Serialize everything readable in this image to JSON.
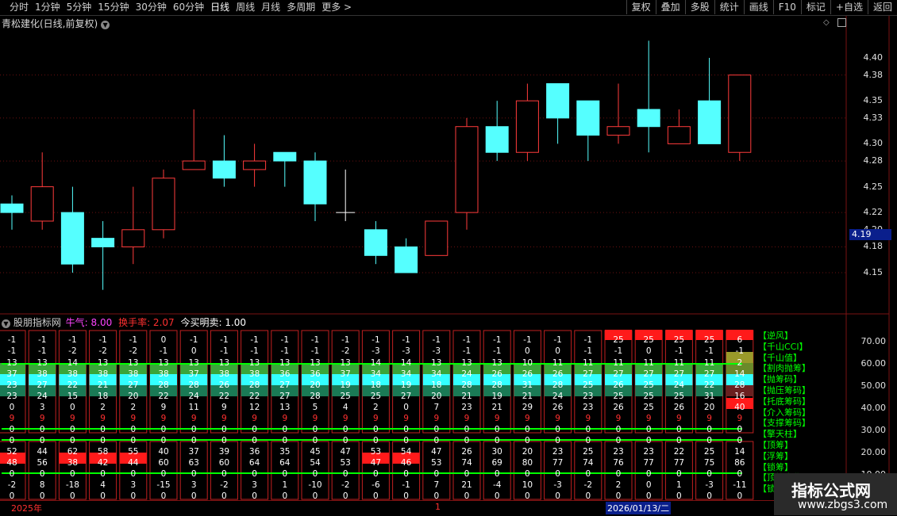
{
  "toolbar": {
    "periods": [
      "分时",
      "1分钟",
      "5分钟",
      "15分钟",
      "30分钟",
      "60分钟",
      "日线",
      "周线",
      "月线",
      "多周期",
      "更多 >"
    ],
    "active_period": "日线",
    "tools": [
      "复权",
      "叠加",
      "多股",
      "统计",
      "画线",
      "F10",
      "标记",
      "+自选",
      "返回"
    ]
  },
  "main_chart": {
    "title": "青松建化(日线,前复权)",
    "price_tag": "4.19",
    "colors": {
      "up": "#ff3b3b",
      "down": "#55ffff",
      "cross": "#ffffff"
    },
    "y_labels": [
      "4.40",
      "4.38",
      "4.35",
      "4.33",
      "4.30",
      "4.28",
      "4.25",
      "4.22",
      "4.20",
      "4.18",
      "4.15"
    ],
    "candles": [
      {
        "o": 4.22,
        "c": 4.23,
        "h": 4.24,
        "l": 4.2,
        "t": "down"
      },
      {
        "o": 4.21,
        "c": 4.25,
        "h": 4.29,
        "l": 4.2,
        "t": "up"
      },
      {
        "o": 4.22,
        "c": 4.16,
        "h": 4.25,
        "l": 4.15,
        "t": "down"
      },
      {
        "o": 4.18,
        "c": 4.19,
        "h": 4.21,
        "l": 4.13,
        "t": "down"
      },
      {
        "o": 4.18,
        "c": 4.2,
        "h": 4.25,
        "l": 4.16,
        "t": "up"
      },
      {
        "o": 4.2,
        "c": 4.26,
        "h": 4.27,
        "l": 4.19,
        "t": "up"
      },
      {
        "o": 4.27,
        "c": 4.28,
        "h": 4.34,
        "l": 4.27,
        "t": "up"
      },
      {
        "o": 4.28,
        "c": 4.26,
        "h": 4.31,
        "l": 4.25,
        "t": "down"
      },
      {
        "o": 4.27,
        "c": 4.28,
        "h": 4.3,
        "l": 4.25,
        "t": "up"
      },
      {
        "o": 4.29,
        "c": 4.28,
        "h": 4.29,
        "l": 4.25,
        "t": "down"
      },
      {
        "o": 4.28,
        "c": 4.23,
        "h": 4.29,
        "l": 4.21,
        "t": "down"
      },
      {
        "o": 4.22,
        "c": 4.22,
        "h": 4.27,
        "l": 4.21,
        "t": "cross"
      },
      {
        "o": 4.2,
        "c": 4.17,
        "h": 4.21,
        "l": 4.16,
        "t": "down"
      },
      {
        "o": 4.18,
        "c": 4.15,
        "h": 4.19,
        "l": 4.15,
        "t": "down"
      },
      {
        "o": 4.17,
        "c": 4.21,
        "h": 4.21,
        "l": 4.17,
        "t": "up"
      },
      {
        "o": 4.22,
        "c": 4.32,
        "h": 4.33,
        "l": 4.2,
        "t": "up"
      },
      {
        "o": 4.32,
        "c": 4.29,
        "h": 4.35,
        "l": 4.28,
        "t": "down"
      },
      {
        "o": 4.29,
        "c": 4.35,
        "h": 4.37,
        "l": 4.28,
        "t": "up"
      },
      {
        "o": 4.37,
        "c": 4.33,
        "h": 4.37,
        "l": 4.3,
        "t": "down"
      },
      {
        "o": 4.35,
        "c": 4.31,
        "h": 4.35,
        "l": 4.28,
        "t": "down"
      },
      {
        "o": 4.31,
        "c": 4.32,
        "h": 4.37,
        "l": 4.3,
        "t": "up"
      },
      {
        "o": 4.34,
        "c": 4.32,
        "h": 4.42,
        "l": 4.29,
        "t": "down"
      },
      {
        "o": 4.3,
        "c": 4.32,
        "h": 4.34,
        "l": 4.3,
        "t": "up"
      },
      {
        "o": 4.35,
        "c": 4.3,
        "h": 4.4,
        "l": 4.3,
        "t": "down"
      },
      {
        "o": 4.29,
        "c": 4.38,
        "h": 4.38,
        "l": 4.28,
        "t": "up"
      }
    ]
  },
  "sub_chart": {
    "indicator_name": "股朋指标网",
    "niuqi_label": "牛气: 8.00",
    "turnover_label": "换手率: 2.07",
    "today_label": "今买明卖: 1.00",
    "y_labels": [
      "70.00",
      "60.00",
      "50.00",
      "40.00",
      "30.00",
      "20.00",
      "10.00"
    ],
    "legend": [
      "【逆风】",
      "【千山CCI】",
      "【千山值】",
      "【割肉抛筹】",
      "【抛筹码】",
      "【抛压筹码】",
      "【托底筹码】",
      "【介入筹码】",
      "【支撑筹码】",
      "【擎天柱】",
      "【顶筹】",
      "【浮筹】",
      "【锁筹】",
      "【顶筹变化】",
      "【锁筹变化】"
    ],
    "rows": {
      "r1": [
        "-1",
        "-1",
        "-1",
        "-1",
        "-1",
        "0",
        "-1",
        "-1",
        "-1",
        "-1",
        "-1",
        "-1",
        "-1",
        "-1",
        "-1",
        "-1",
        "-1",
        "-1",
        "-1",
        "-1",
        "25",
        "25",
        "25",
        "25",
        "6"
      ],
      "r2": [
        "-1",
        "-1",
        "-2",
        "-2",
        "-2",
        "-1",
        "0",
        "-1",
        "-1",
        "-1",
        "-1",
        "-2",
        "-3",
        "-3",
        "-3",
        "-1",
        "-1",
        "0",
        "0",
        "-1",
        "-1",
        "0",
        "-1",
        "-1",
        "-1"
      ],
      "r3": [
        "13",
        "13",
        "14",
        "13",
        "13",
        "13",
        "13",
        "13",
        "13",
        "13",
        "13",
        "13",
        "14",
        "14",
        "13",
        "13",
        "13",
        "10",
        "11",
        "11",
        "11",
        "11",
        "11",
        "11",
        "2"
      ],
      "r4": [
        "37",
        "38",
        "38",
        "38",
        "38",
        "38",
        "37",
        "38",
        "38",
        "36",
        "36",
        "37",
        "34",
        "34",
        "34",
        "24",
        "26",
        "26",
        "26",
        "27",
        "27",
        "27",
        "27",
        "27",
        "14"
      ],
      "r5": [
        "23",
        "27",
        "22",
        "21",
        "27",
        "28",
        "28",
        "26",
        "28",
        "27",
        "20",
        "19",
        "18",
        "19",
        "18",
        "28",
        "28",
        "31",
        "28",
        "25",
        "26",
        "25",
        "24",
        "22",
        "28"
      ],
      "r6": [
        "23",
        "24",
        "15",
        "18",
        "20",
        "22",
        "24",
        "22",
        "22",
        "27",
        "28",
        "25",
        "25",
        "27",
        "20",
        "21",
        "19",
        "21",
        "24",
        "23",
        "25",
        "25",
        "25",
        "31",
        "16"
      ],
      "r7": [
        "0",
        "3",
        "0",
        "2",
        "2",
        "9",
        "11",
        "9",
        "12",
        "13",
        "5",
        "4",
        "2",
        "0",
        "7",
        "23",
        "21",
        "29",
        "26",
        "23",
        "26",
        "25",
        "26",
        "20",
        "40"
      ],
      "r8": [
        "9",
        "9",
        "9",
        "9",
        "9",
        "9",
        "9",
        "9",
        "9",
        "9",
        "9",
        "9",
        "9",
        "9",
        "9",
        "9",
        "9",
        "9",
        "9",
        "9",
        "9",
        "9",
        "9",
        "9",
        "9"
      ],
      "r9": [
        "0",
        "0",
        "0",
        "0",
        "0",
        "0",
        "0",
        "0",
        "0",
        "0",
        "0",
        "0",
        "0",
        "0",
        "0",
        "0",
        "0",
        "0",
        "0",
        "0",
        "0",
        "0",
        "0",
        "0",
        "0"
      ],
      "r10": [
        "0",
        "0",
        "0",
        "0",
        "0",
        "0",
        "0",
        "0",
        "0",
        "0",
        "0",
        "0",
        "0",
        "0",
        "0",
        "0",
        "0",
        "0",
        "0",
        "0",
        "0",
        "0",
        "0",
        "0",
        "0"
      ],
      "r11": [
        "52",
        "44",
        "62",
        "58",
        "55",
        "40",
        "37",
        "39",
        "36",
        "35",
        "45",
        "47",
        "53",
        "54",
        "47",
        "26",
        "30",
        "20",
        "23",
        "25",
        "23",
        "23",
        "22",
        "25",
        "14"
      ],
      "r12": [
        "48",
        "56",
        "38",
        "42",
        "44",
        "60",
        "63",
        "60",
        "64",
        "64",
        "54",
        "53",
        "47",
        "46",
        "53",
        "74",
        "69",
        "80",
        "77",
        "74",
        "76",
        "77",
        "77",
        "75",
        "86"
      ],
      "r13": [
        "0",
        "0",
        "0",
        "0",
        "0",
        "0",
        "0",
        "0",
        "0",
        "0",
        "0",
        "0",
        "0",
        "0",
        "0",
        "0",
        "0",
        "0",
        "0",
        "0",
        "0",
        "0",
        "0",
        "0",
        "0"
      ],
      "r14": [
        "-2",
        "8",
        "-18",
        "4",
        "3",
        "-15",
        "3",
        "-2",
        "3",
        "1",
        "-10",
        "-2",
        "-6",
        "-1",
        "7",
        "21",
        "-4",
        "10",
        "-3",
        "-2",
        "2",
        "0",
        "1",
        "-3",
        "-11"
      ],
      "r15": [
        "0",
        "0",
        "0",
        "0",
        "0",
        "0",
        "0",
        "0",
        "0",
        "0",
        "0",
        "0",
        "0",
        "0",
        "0",
        "0",
        "0",
        "0",
        "0",
        "0",
        "0",
        "0",
        "0",
        "0",
        "0"
      ]
    },
    "highlights": {
      "r1_red_from": 20,
      "r12_red_cols": [
        0,
        2,
        3,
        4,
        12,
        13
      ],
      "r7_red_cols": [
        24
      ]
    },
    "colors": {
      "red": "#ff1a1a",
      "green": "#3aa53a",
      "cyan": "#33ffff",
      "teal": "#1a7a55",
      "olive": "#9a9a2a",
      "bright_green": "#00ff00",
      "border": "#c02020"
    }
  },
  "date_bar": {
    "year_label": "2025年",
    "marker": "1",
    "date": "2026/01/13/二"
  },
  "watermark": {
    "title": "指标公式网",
    "url": "www.zbgs3.com"
  }
}
